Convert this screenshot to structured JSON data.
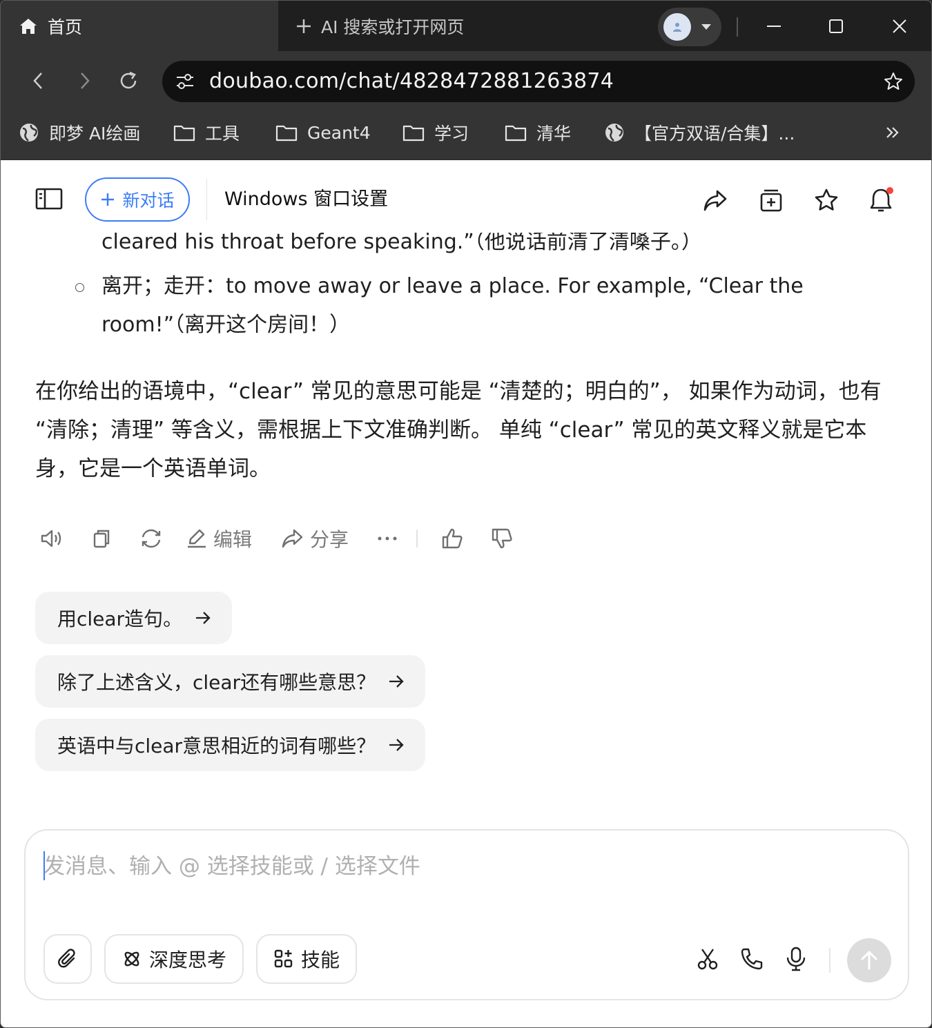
{
  "browser": {
    "active_tab": {
      "icon": "home-icon",
      "label": "首页"
    },
    "new_tab": {
      "label": "AI 搜索或打开网页"
    },
    "url": "doubao.com/chat/4828472881263874",
    "bookmarks": [
      {
        "icon": "globe-icon",
        "label": "即梦 AI绘画"
      },
      {
        "icon": "folder-icon",
        "label": "工具"
      },
      {
        "icon": "folder-icon",
        "label": "Geant4"
      },
      {
        "icon": "folder-icon",
        "label": "学习"
      },
      {
        "icon": "folder-icon",
        "label": "清华"
      },
      {
        "icon": "globe-icon",
        "label": "【官方双语/合集】..."
      }
    ]
  },
  "header": {
    "new_chat_label": "新对话",
    "title": "Windows 窗口设置"
  },
  "conversation": {
    "cut_off_line": "cleared his throat before speaking.”（他说话前清了清嗓子。）",
    "sub_item": "离开；走开：to move away or leave a place. For example, “Clear the room!”（离开这个房间！）",
    "paragraph": "在你给出的语境中，“clear” 常见的意思可能是 “清楚的；明白的”， 如果作为动词，也有 “清除；清理” 等含义，需根据上下文准确判断。 单纯 “clear” 常见的英文释义就是它本身，它是一个英语单词。"
  },
  "actions": {
    "edit_label": "编辑",
    "share_label": "分享"
  },
  "suggestions": [
    "用clear造句。",
    "除了上述含义，clear还有哪些意思？",
    "英语中与clear意思相近的词有哪些？"
  ],
  "composer": {
    "placeholder": "发消息、输入 @ 选择技能或 / 选择文件",
    "deep_think_label": "深度思考",
    "skills_label": "技能"
  },
  "colors": {
    "accent": "#3b7cf6",
    "notification_dot": "#f5453a"
  }
}
